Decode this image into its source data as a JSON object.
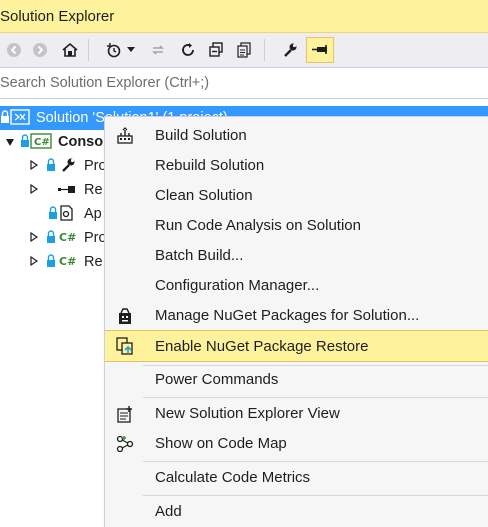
{
  "panel": {
    "title": "Solution Explorer"
  },
  "toolbar": {
    "buttons": [
      "back-icon",
      "forward-icon",
      "home-icon",
      "history-icon",
      "dropdown-arrow-icon",
      "sync-icon",
      "refresh-icon",
      "collapse-all-icon",
      "show-all-files-icon",
      "properties-icon",
      "pin-icon"
    ]
  },
  "search": {
    "placeholder": "Search Solution Explorer (Ctrl+;)"
  },
  "tree": {
    "solution_label": "Solution 'Solution1' (1 project)",
    "project_label": "Conso",
    "items": [
      {
        "label": "Pro",
        "icon": "wrench-icon"
      },
      {
        "label": "Re",
        "icon": "references-icon"
      },
      {
        "label": "Ap",
        "icon": "config-file-icon"
      },
      {
        "label": "Pro",
        "icon": "csharp-file-icon"
      },
      {
        "label": "Re",
        "icon": "csharp-file-icon"
      }
    ]
  },
  "context_menu": {
    "items": [
      {
        "label": "Build Solution",
        "icon": "build-icon"
      },
      {
        "label": "Rebuild Solution"
      },
      {
        "label": "Clean Solution"
      },
      {
        "label": "Run Code Analysis on Solution"
      },
      {
        "label": "Batch Build..."
      },
      {
        "label": "Configuration Manager..."
      },
      {
        "label": "Manage NuGet Packages for Solution...",
        "icon": "nuget-icon"
      },
      {
        "label": "Enable NuGet Package Restore",
        "icon": "package-restore-icon",
        "highlighted": true
      },
      {
        "label": "Power Commands"
      },
      {
        "label": "New Solution Explorer View",
        "icon": "new-view-icon"
      },
      {
        "label": "Show on Code Map",
        "icon": "code-map-icon"
      },
      {
        "label": "Calculate Code Metrics"
      },
      {
        "label": "Add"
      }
    ]
  },
  "colors": {
    "accent": "#fff29d",
    "selection": "#3399ff",
    "menu_bg": "#f6f6f6"
  }
}
